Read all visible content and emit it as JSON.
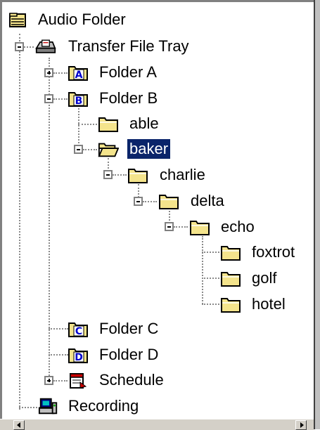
{
  "tree": {
    "root": "Audio Folder",
    "transfer_tray": "Transfer File Tray",
    "folder_a": "Folder A",
    "folder_b": "Folder B",
    "able": "able",
    "baker": "baker",
    "charlie": "charlie",
    "delta": "delta",
    "echo": "echo",
    "foxtrot": "foxtrot",
    "golf": "golf",
    "hotel": "hotel",
    "folder_c": "Folder C",
    "folder_d": "Folder D",
    "schedule": "Schedule",
    "recording": "Recording"
  },
  "badges": {
    "a": "A",
    "b": "B",
    "c": "C",
    "d": "D"
  },
  "selected_item": "baker",
  "colors": {
    "selection": "#0a246a",
    "folder": "#f4e48c",
    "badge": "#0000cc"
  }
}
